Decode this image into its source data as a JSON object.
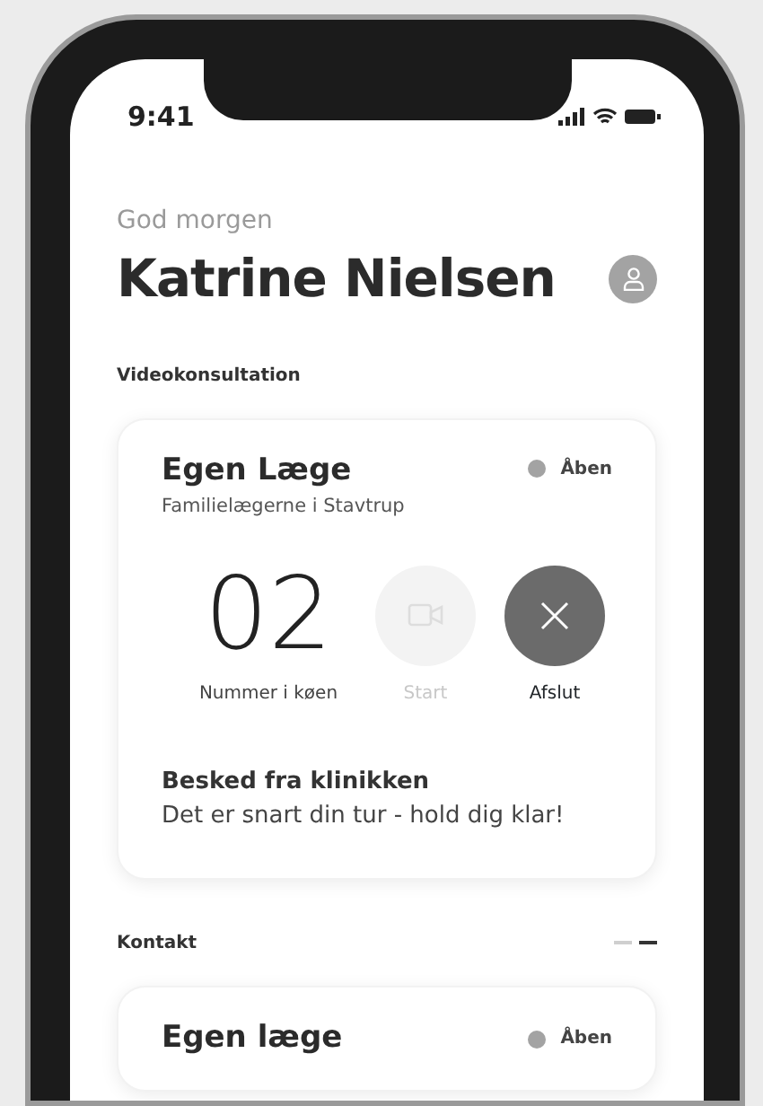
{
  "status_bar": {
    "time": "9:41"
  },
  "header": {
    "greeting": "God morgen",
    "name": "Katrine Nielsen"
  },
  "video_section": {
    "title": "Videokonsultation",
    "card": {
      "title": "Egen Læge",
      "subtitle": "Familielægerne i Stavtrup",
      "status": {
        "text": "Åben",
        "color": "#a3a3a3"
      },
      "queue_number": "02",
      "queue_label": "Nummer i køen",
      "actions": [
        {
          "kind": "start",
          "label": "Start",
          "disabled": true
        },
        {
          "kind": "end",
          "label": "Afslut",
          "disabled": false
        }
      ],
      "message_title": "Besked fra klinikken",
      "message": "Det er snart din tur - hold dig klar!"
    }
  },
  "contact_section": {
    "title": "Kontakt",
    "pager": [
      {
        "selected": false
      },
      {
        "selected": true
      }
    ],
    "card": {
      "title": "Egen læge",
      "status": {
        "text": "Åben",
        "color": "#a3a3a3"
      }
    }
  }
}
